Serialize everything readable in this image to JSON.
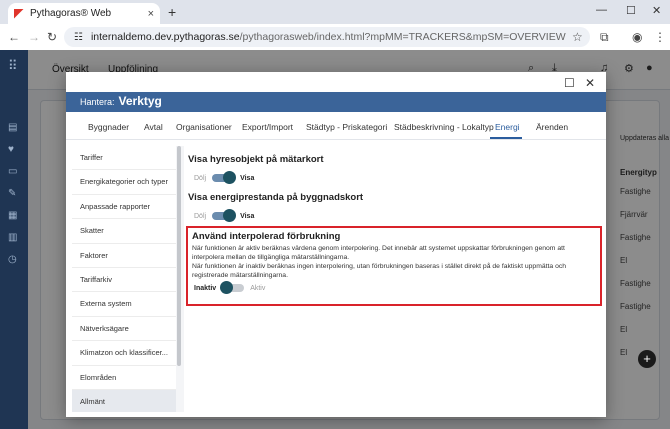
{
  "browser": {
    "tab_title": "Pythagoras® Web",
    "tab_close": "×",
    "new_tab": "+",
    "url_host": "internaldemo.dev.pythagoras.se",
    "url_path": "/pythagorasweb/index.html?mpMM=TRACKERS&mpSM=OVERVIEW"
  },
  "app": {
    "header_tabs": [
      "Översikt",
      "Uppföljning"
    ],
    "right_header": "Energityp",
    "right_label": "Uppdateras alla",
    "right_cells": [
      "Fastighe",
      "Fjärrvär",
      "Fastighe",
      "El",
      "Fastighe",
      "Fastighe",
      "El",
      "El"
    ]
  },
  "modal": {
    "header_prefix": "Hantera:",
    "header_title": "Verktyg",
    "tabs": [
      "Byggnader",
      "Avtal",
      "Organisationer",
      "Export/Import",
      "Städtyp - Priskategori",
      "Städbeskrivning - Lokaltyp",
      "Energi",
      "Ärenden"
    ],
    "active_tab": "Energi",
    "side_items": [
      "Tariffer",
      "Energikategorier och typer",
      "Anpassade rapporter",
      "Skatter",
      "Faktorer",
      "Tariffarkiv",
      "Externa system",
      "Nätverksägare",
      "Klimatzon och klassificer...",
      "Elområden",
      "Allmänt"
    ],
    "selected_item": "Allmänt",
    "sections": {
      "s1_title": "Visa hyresobjekt på mätarkort",
      "s1_off": "Dölj",
      "s1_on": "Visa",
      "s2_title": "Visa energiprestanda på byggnadskort",
      "s2_off": "Dölj",
      "s2_on": "Visa",
      "s3_title": "Använd interpolerad förbrukning",
      "s3_desc1": "När funktionen är aktiv beräknas värdena genom interpolering. Det innebär att systemet uppskattar förbrukningen genom att interpolera mellan de tillgängliga mätarställningarna.",
      "s3_desc2": "När funktionen är inaktiv beräknas ingen interpolering, utan förbrukningen baseras i stället direkt på de faktiskt uppmätta och registrerade mätarställningarna.",
      "s3_off": "Inaktiv",
      "s3_on": "Aktiv"
    }
  },
  "colors": {
    "modal_header": "#3b6499",
    "active_tab": "#2b5d9e",
    "highlight_border": "#d9232a",
    "toggle_knob": "#1d5261"
  }
}
